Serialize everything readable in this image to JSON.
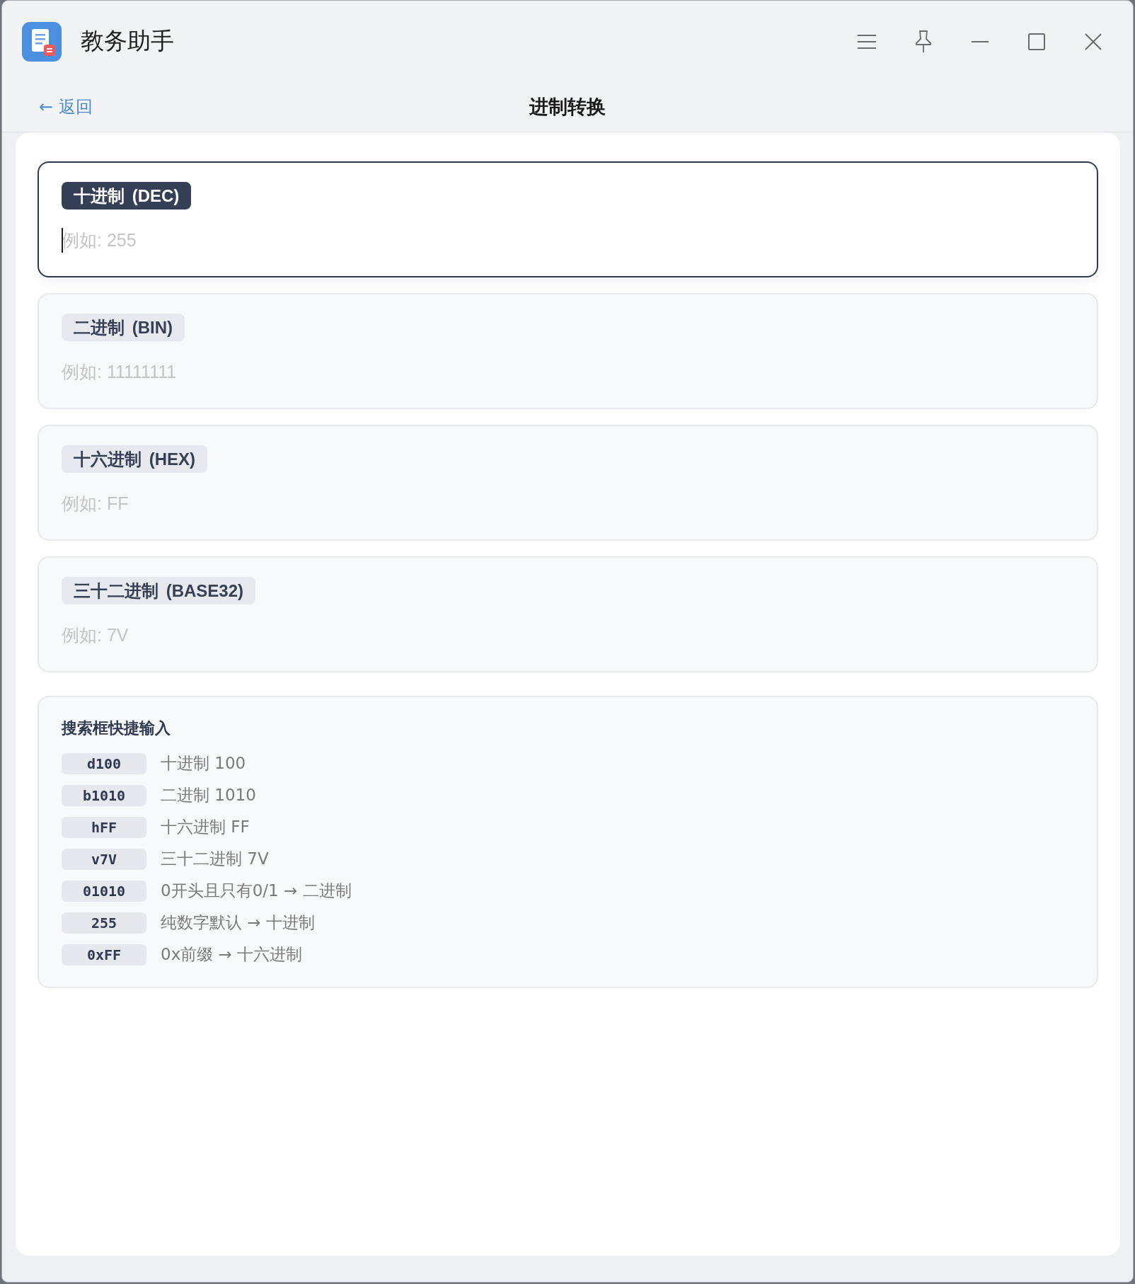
{
  "window": {
    "title": "教务助手"
  },
  "header": {
    "back_link": "← 返回",
    "title": "进制转换"
  },
  "fields": [
    {
      "label": "十进制 (DEC)",
      "placeholder": "例如: 255",
      "focused": true
    },
    {
      "label": "二进制 (BIN)",
      "placeholder": "例如: 11111111",
      "focused": false
    },
    {
      "label": "十六进制 (HEX)",
      "placeholder": "例如: FF",
      "focused": false
    },
    {
      "label": "三十二进制 (BASE32)",
      "placeholder": "例如: 7V",
      "focused": false
    }
  ],
  "shortcuts": {
    "title": "搜索框快捷输入",
    "items": [
      {
        "key": "d100",
        "description": "十进制 100"
      },
      {
        "key": "b1010",
        "description": "二进制 1010"
      },
      {
        "key": "hFF",
        "description": "十六进制 FF"
      },
      {
        "key": "v7V",
        "description": "三十二进制 7V"
      },
      {
        "key": "01010",
        "description": "0开头且只有0/1 → 二进制"
      },
      {
        "key": "255",
        "description": "纯数字默认 → 十进制"
      },
      {
        "key": "0xFF",
        "description": "0x前缀 → 十六进制"
      }
    ]
  }
}
